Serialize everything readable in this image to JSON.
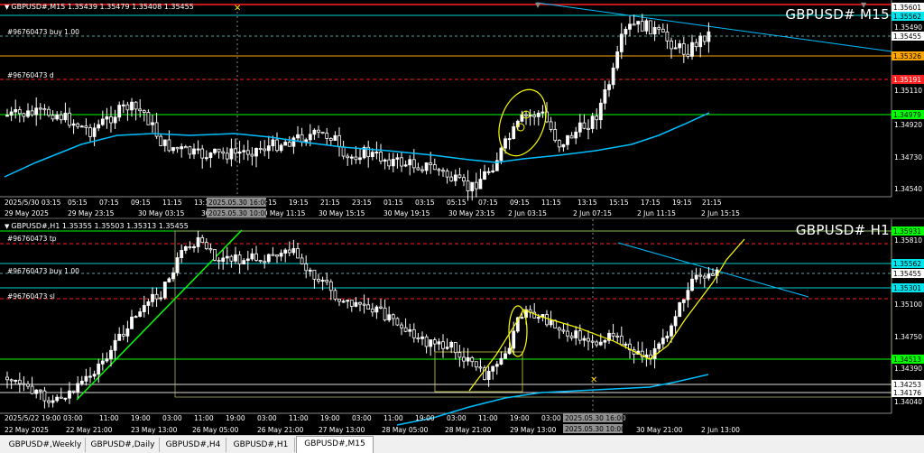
{
  "top_chart": {
    "symbol_info": "GBPUSD#,M15  1.35439 1.35479 1.35408 1.35455",
    "title": "GBPUSD# M15",
    "price_scale": [
      "1.35490",
      "1.35310",
      "1.35110",
      "1.34920",
      "1.34730",
      "1.34540"
    ],
    "time_labels": [
      "2025/5/30 03:15",
      "05:15",
      "07:15",
      "09:15",
      "11:15",
      "13:15",
      "15:15",
      "17:15",
      "19:15",
      "21:15",
      "23:15",
      "01:15",
      "03:15",
      "05:15",
      "07:15",
      "09:15",
      "11:15",
      "13:15",
      "15:15",
      "17:15",
      "19:15",
      "21:15"
    ],
    "date_labels": [
      "29 May 2025",
      "29 May 23:15",
      "30 May 03:15",
      "30 May 07:15",
      "30 May 11:15",
      "30 May 15:15",
      "30 May 19:15",
      "30 May 23:15",
      "2 Jun 03:15",
      "2 Jun 07:15",
      "2 Jun 11:15",
      "2 Jun 15:15"
    ],
    "crosshair_time_top": "2025.05.30 16:00",
    "crosshair_time_bottom": "2025.05.30 10:00",
    "order_lines": [
      {
        "label": "#96760473 buy 1.00",
        "price": "1.35455",
        "color": "#5f9ea0"
      },
      {
        "label": "#96760473 d",
        "price": "1.35191",
        "color": "#ff3030"
      }
    ],
    "price_tags": [
      {
        "value": "1.35601",
        "bg": "#ffffff",
        "fg": "#000000"
      },
      {
        "value": "1.35562",
        "bg": "#00e5ee",
        "fg": "#000000"
      },
      {
        "value": "1.35455",
        "bg": "#ffffff",
        "fg": "#000000"
      },
      {
        "value": "1.35326",
        "bg": "#ffa500",
        "fg": "#000000"
      },
      {
        "value": "1.35191",
        "bg": "#ff2020",
        "fg": "#ffffff"
      },
      {
        "value": "1.34979",
        "bg": "#00ff00",
        "fg": "#000000"
      }
    ]
  },
  "bottom_chart": {
    "symbol_info": "GBPUSD#,H1  1.35355 1.35503 1.35313 1.35455",
    "title": "GBPUSD# H1",
    "price_scale": [
      "1.35810",
      "1.35100",
      "1.34750",
      "1.34390",
      "1.34040"
    ],
    "time_labels": [
      "2025/5/22 19:00",
      "03:00",
      "11:00",
      "19:00",
      "03:00",
      "11:00",
      "19:00",
      "03:00",
      "11:00",
      "19:00",
      "03:00",
      "11:00",
      "19:00",
      "03:00",
      "11:00",
      "19:00",
      "03:00",
      "11:00",
      "19:00"
    ],
    "date_labels": [
      "22 May 2025",
      "22 May 21:00",
      "23 May 13:00",
      "26 May 05:00",
      "26 May 21:00",
      "27 May 13:00",
      "28 May 05:00",
      "28 May 21:00",
      "29 May 13:00",
      "30 May 21:00",
      "2 Jun 13:00"
    ],
    "crosshair_time": "2025.05.30 16:00",
    "crosshair_time_bottom": "2025.05.30 10:00",
    "order_lines": [
      {
        "label": "#96760473 tp",
        "price": "1.35931",
        "color": "#ff3030"
      },
      {
        "label": "#96760473 buy 1.00",
        "price": "1.35455",
        "color": "#5f9ea0"
      },
      {
        "label": "#96760473 sl",
        "price": "1.35301",
        "color": "#ff3030"
      }
    ],
    "price_tags": [
      {
        "value": "1.35931",
        "bg": "#00ff00",
        "fg": "#000000"
      },
      {
        "value": "1.35562",
        "bg": "#00e5ee",
        "fg": "#000000"
      },
      {
        "value": "1.35455",
        "bg": "#ffffff",
        "fg": "#000000"
      },
      {
        "value": "1.35301",
        "bg": "#00e5ee",
        "fg": "#000000"
      },
      {
        "value": "1.34513",
        "bg": "#00ff00",
        "fg": "#000000"
      },
      {
        "value": "1.34253",
        "bg": "#ffffff",
        "fg": "#000000"
      },
      {
        "value": "1.34176",
        "bg": "#ffffff",
        "fg": "#000000"
      }
    ]
  },
  "tabs": [
    "GBPUSD#,Weekly",
    "GBPUSD#,Daily",
    "GBPUSD#,H4",
    "GBPUSD#,H1",
    "GBPUSD#,M15"
  ],
  "active_tab": "GBPUSD#,M15",
  "colors": {
    "background": "#000000",
    "candle": "#ffffff",
    "moving_average": "#00bfff",
    "trendline": "#00ff00",
    "annotation": "#ffff00",
    "grid": "#5a5a5a"
  }
}
